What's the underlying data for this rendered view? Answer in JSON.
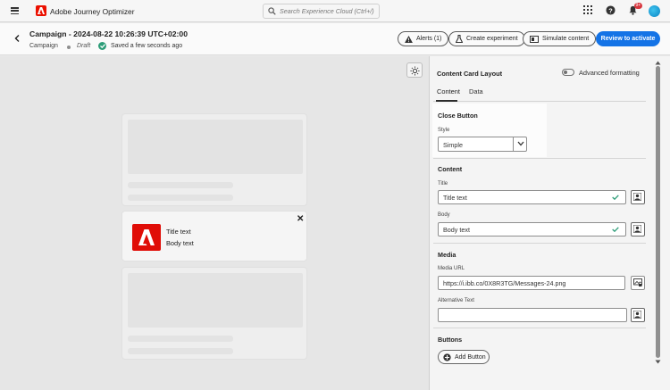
{
  "app": {
    "brand_name": "Adobe Journey Optimizer",
    "notification_count": "9+"
  },
  "search": {
    "placeholder": "Search Experience Cloud (Ctrl+/)"
  },
  "header": {
    "campaign_title": "Campaign - 2024-08-22 10:26:39 UTC+02:00",
    "breadcrumb": "Campaign",
    "status": "Draft",
    "saved_text": "Saved a few seconds ago",
    "alerts_label": "Alerts (1)",
    "create_experiment_label": "Create experiment",
    "simulate_content_label": "Simulate content",
    "review_label": "Review to activate"
  },
  "preview": {
    "card_title": "Title text",
    "card_body": "Body text",
    "close_glyph": "✕"
  },
  "panel": {
    "title": "Content Card Layout",
    "advanced_formatting_label": "Advanced formatting",
    "advanced_formatting_on": false,
    "tabs": [
      {
        "label": "Content",
        "active": true
      },
      {
        "label": "Data",
        "active": false
      }
    ],
    "close_button": {
      "heading": "Close Button",
      "style_label": "Style",
      "style_value": "Simple"
    },
    "content": {
      "heading": "Content",
      "title_label": "Title",
      "title_value": "Title text",
      "body_label": "Body",
      "body_value": "Body text"
    },
    "media": {
      "heading": "Media",
      "url_label": "Media URL",
      "url_value": "https://i.ibb.co/0X8R3TG/Messages-24.png",
      "alt_label": "Alternative Text",
      "alt_value": ""
    },
    "buttons": {
      "heading": "Buttons",
      "add_label": "Add Button"
    }
  },
  "colors": {
    "accent": "#1473e6",
    "brand": "#eb1000",
    "success": "#2d9d78"
  }
}
